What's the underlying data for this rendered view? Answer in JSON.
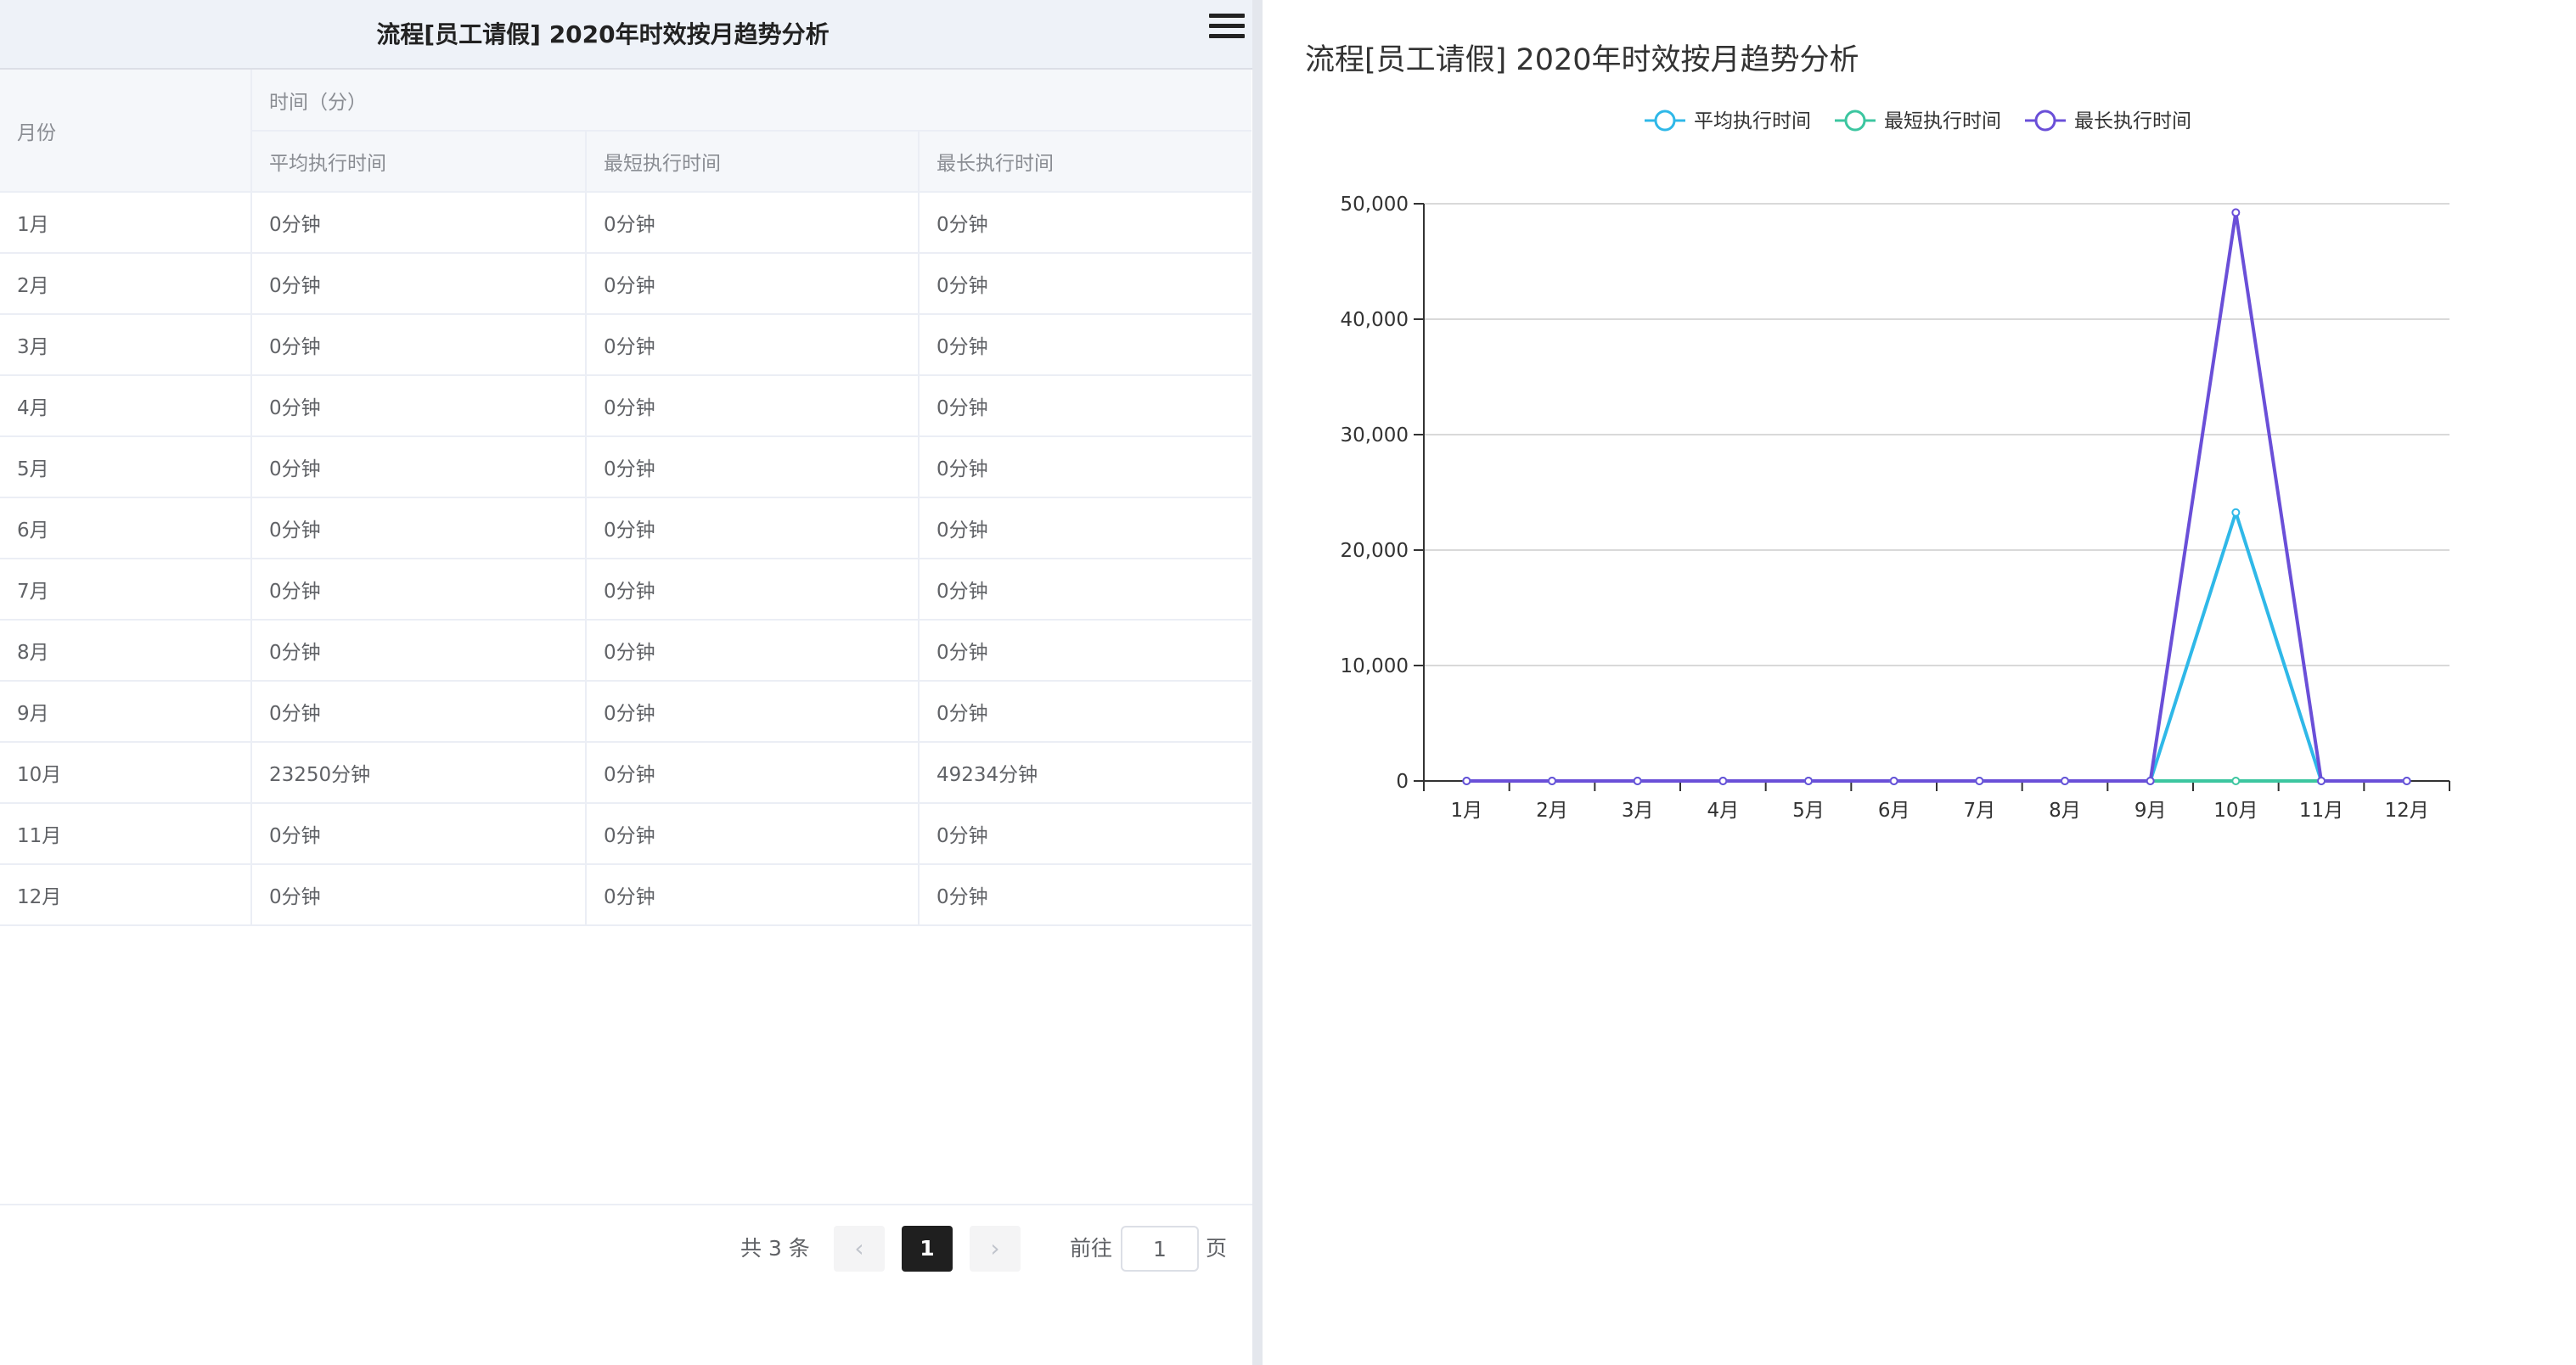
{
  "left": {
    "title": "流程[员工请假] 2020年时效按月趋势分析",
    "table": {
      "month_header": "月份",
      "group_header": "时间（分）",
      "columns": [
        "平均执行时间",
        "最短执行时间",
        "最长执行时间"
      ],
      "rows": [
        [
          "1月",
          "0分钟",
          "0分钟",
          "0分钟"
        ],
        [
          "2月",
          "0分钟",
          "0分钟",
          "0分钟"
        ],
        [
          "3月",
          "0分钟",
          "0分钟",
          "0分钟"
        ],
        [
          "4月",
          "0分钟",
          "0分钟",
          "0分钟"
        ],
        [
          "5月",
          "0分钟",
          "0分钟",
          "0分钟"
        ],
        [
          "6月",
          "0分钟",
          "0分钟",
          "0分钟"
        ],
        [
          "7月",
          "0分钟",
          "0分钟",
          "0分钟"
        ],
        [
          "8月",
          "0分钟",
          "0分钟",
          "0分钟"
        ],
        [
          "9月",
          "0分钟",
          "0分钟",
          "0分钟"
        ],
        [
          "10月",
          "23250分钟",
          "0分钟",
          "49234分钟"
        ],
        [
          "11月",
          "0分钟",
          "0分钟",
          "0分钟"
        ],
        [
          "12月",
          "0分钟",
          "0分钟",
          "0分钟"
        ]
      ]
    },
    "pagination": {
      "total": "共 3 条",
      "prev_icon": "chevron-left-icon",
      "prev_label": "‹",
      "current_page": "1",
      "next_icon": "chevron-right-icon",
      "next_label": "›",
      "goto_label": "前往",
      "goto_value": "1",
      "goto_unit": "页"
    },
    "menu_icon": "hamburger-menu-icon"
  },
  "chart_data": {
    "type": "line",
    "title": "流程[员工请假] 2020年时效按月趋势分析",
    "categories": [
      "1月",
      "2月",
      "3月",
      "4月",
      "5月",
      "6月",
      "7月",
      "8月",
      "9月",
      "10月",
      "11月",
      "12月"
    ],
    "series": [
      {
        "name": "平均执行时间",
        "color": "#2fb8e8",
        "values": [
          0,
          0,
          0,
          0,
          0,
          0,
          0,
          0,
          0,
          23250,
          0,
          0
        ]
      },
      {
        "name": "最短执行时间",
        "color": "#3cc6a0",
        "values": [
          0,
          0,
          0,
          0,
          0,
          0,
          0,
          0,
          0,
          0,
          0,
          0
        ]
      },
      {
        "name": "最长执行时间",
        "color": "#6a4fd8",
        "values": [
          0,
          0,
          0,
          0,
          0,
          0,
          0,
          0,
          0,
          49234,
          0,
          0
        ]
      }
    ],
    "yticks": [
      "0",
      "10,000",
      "20,000",
      "30,000",
      "40,000",
      "50,000"
    ],
    "ylim": [
      0,
      50000
    ],
    "grid": true,
    "legend": "top-center"
  }
}
